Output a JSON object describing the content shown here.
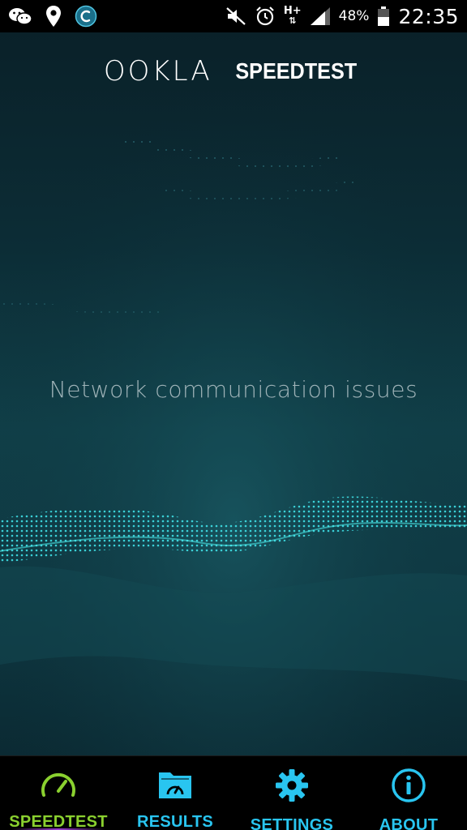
{
  "status_bar": {
    "left_icons": [
      "wechat-icon",
      "location-pin-icon",
      "app-circle-icon"
    ],
    "right_icons": [
      "mute-icon",
      "alarm-icon",
      "hplus-network-icon",
      "signal-icon",
      "battery-icon"
    ],
    "network_type": "H+",
    "battery_percent": "48%",
    "time": "22:35"
  },
  "header": {
    "logo_brand": "OOKLA",
    "logo_product": "SPEEDTEST"
  },
  "main": {
    "message": "Network communication issues"
  },
  "nav": {
    "items": [
      {
        "label": "SPEEDTEST",
        "icon": "speedometer-icon",
        "active": true
      },
      {
        "label": "RESULTS",
        "icon": "results-folder-icon",
        "active": false
      },
      {
        "label": "SETTINGS",
        "icon": "gear-icon",
        "active": false
      },
      {
        "label": "ABOUT",
        "icon": "info-icon",
        "active": false
      }
    ]
  },
  "colors": {
    "nav_active": "#8ad02f",
    "nav_inactive": "#29c5f0",
    "accent_wave": "#2fd5dc",
    "background": "#0c2d36"
  }
}
